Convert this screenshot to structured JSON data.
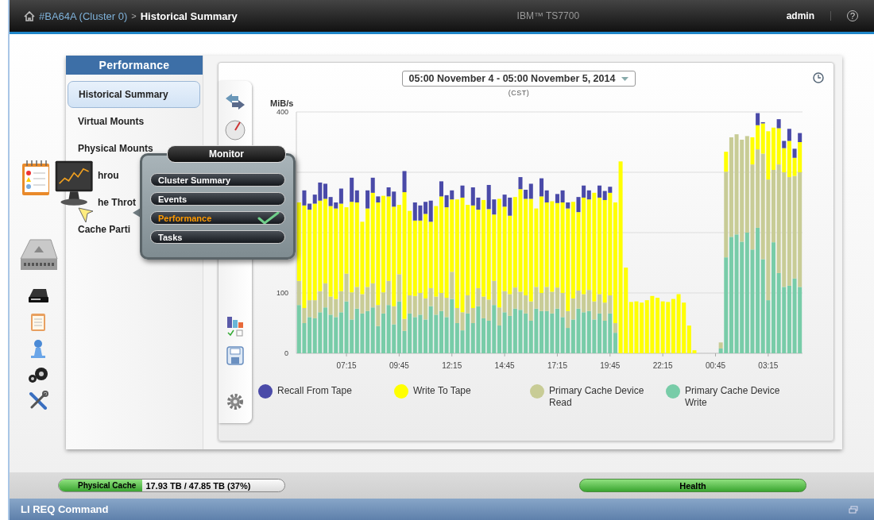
{
  "header": {
    "breadcrumb": [
      {
        "label": "#BA64A (Cluster 0)",
        "kind": "link"
      },
      {
        "label": ">",
        "kind": "separator"
      },
      {
        "label": "Historical Summary",
        "kind": "current"
      }
    ],
    "product": "IBM™ TS7700",
    "user": "admin",
    "help": "?"
  },
  "nav": {
    "title": "Performance",
    "items": [
      {
        "label": "Historical Summary",
        "selected": true,
        "covered": false
      },
      {
        "label": "Virtual Mounts",
        "selected": false,
        "covered": false
      },
      {
        "label": "Physical Mounts",
        "selected": false,
        "covered": false
      },
      {
        "label": "hrou",
        "selected": false,
        "covered": true
      },
      {
        "label": "he Throt",
        "selected": false,
        "covered": true
      },
      {
        "label": "Cache Parti",
        "selected": false,
        "covered": false
      }
    ]
  },
  "monitor_menu": {
    "title": "Monitor",
    "items": [
      {
        "label": "Cluster Summary",
        "selected": false
      },
      {
        "label": "Events",
        "selected": false
      },
      {
        "label": "Performance",
        "selected": true
      },
      {
        "label": "Tasks",
        "selected": false
      }
    ]
  },
  "chart_panel": {
    "date_range": "05:00 November 4 - 05:00 November 5, 2014",
    "timezone": "(CST)",
    "chart_data": {
      "type": "bar",
      "stacked": true,
      "ylabel": "MiB/s",
      "ylim": [
        0,
        400
      ],
      "yticks": [
        0,
        100,
        400
      ],
      "categories": [
        null,
        null,
        null,
        null,
        null,
        null,
        null,
        null,
        null,
        "07:15",
        null,
        null,
        null,
        null,
        null,
        null,
        null,
        null,
        null,
        "09:45",
        null,
        null,
        null,
        null,
        null,
        null,
        null,
        null,
        null,
        "12:15",
        null,
        null,
        null,
        null,
        null,
        null,
        null,
        null,
        null,
        "14:45",
        null,
        null,
        null,
        null,
        null,
        null,
        null,
        null,
        null,
        "17:15",
        null,
        null,
        null,
        null,
        null,
        null,
        null,
        null,
        null,
        "19:45",
        null,
        null,
        null,
        null,
        null,
        null,
        null,
        null,
        null,
        "22:15",
        null,
        null,
        null,
        null,
        null,
        null,
        null,
        null,
        null,
        "00:45",
        null,
        null,
        null,
        null,
        null,
        null,
        null,
        null,
        null,
        "03:15",
        null,
        null,
        null,
        null,
        null,
        null
      ],
      "series": [
        {
          "name": "Recall From Tape",
          "color": "#4a4aa8",
          "values": [
            0,
            25,
            10,
            15,
            30,
            25,
            15,
            10,
            25,
            0,
            40,
            20,
            0,
            30,
            25,
            10,
            0,
            15,
            25,
            0,
            35,
            0,
            30,
            25,
            20,
            35,
            0,
            25,
            20,
            15,
            0,
            20,
            0,
            30,
            20,
            0,
            40,
            25,
            0,
            20,
            30,
            0,
            20,
            15,
            25,
            0,
            30,
            20,
            0,
            15,
            20,
            10,
            0,
            25,
            20,
            15,
            0,
            20,
            15,
            10,
            0,
            0,
            0,
            0,
            0,
            0,
            0,
            0,
            0,
            0,
            0,
            0,
            0,
            0,
            0,
            0,
            0,
            0,
            0,
            0,
            0,
            0,
            0,
            0,
            0,
            0,
            0,
            20,
            2,
            0,
            0,
            15,
            12,
            20,
            15,
            15
          ]
        },
        {
          "name": "Write To Tape",
          "color": "#ffff00",
          "values": [
            130,
            170,
            150,
            160,
            150,
            140,
            150,
            150,
            145,
            110,
            150,
            140,
            120,
            130,
            150,
            170,
            160,
            140,
            165,
            115,
            210,
            140,
            125,
            120,
            140,
            110,
            150,
            160,
            150,
            120,
            180,
            190,
            150,
            170,
            130,
            160,
            150,
            110,
            180,
            140,
            130,
            150,
            170,
            160,
            170,
            130,
            160,
            140,
            150,
            140,
            150,
            170,
            160,
            130,
            160,
            150,
            180,
            160,
            170,
            170,
            200,
            318,
            142,
            85,
            86,
            84,
            88,
            95,
            92,
            86,
            85,
            90,
            98,
            84,
            46,
            5,
            0,
            0,
            0,
            0,
            0,
            33,
            0,
            0,
            0,
            0,
            45,
            40,
            50,
            80,
            70,
            60,
            40,
            60,
            30,
            50
          ]
        },
        {
          "name": "Primary Cache Device Read",
          "color": "#c8cc96",
          "values": [
            40,
            25,
            28,
            30,
            35,
            40,
            30,
            30,
            35,
            46,
            45,
            36,
            32,
            40,
            40,
            35,
            35,
            40,
            30,
            45,
            20,
            30,
            35,
            36,
            35,
            30,
            30,
            30,
            32,
            45,
            25,
            30,
            30,
            25,
            30,
            36,
            35,
            40,
            30,
            35,
            36,
            35,
            30,
            30,
            32,
            36,
            30,
            40,
            36,
            35,
            40,
            28,
            35,
            30,
            30,
            35,
            30,
            32,
            30,
            30,
            16,
            0,
            0,
            0,
            0,
            0,
            0,
            0,
            0,
            0,
            0,
            0,
            0,
            0,
            0,
            0,
            0,
            0,
            0,
            0,
            10,
            142,
            165,
            166,
            169,
            160,
            141,
            130,
            175,
            200,
            120,
            180,
            190,
            180,
            170,
            190
          ]
        },
        {
          "name": "Primary Cache Device Write",
          "color": "#78cca8",
          "values": [
            80,
            50,
            60,
            58,
            68,
            76,
            64,
            60,
            68,
            86,
            56,
            74,
            66,
            70,
            76,
            45,
            66,
            80,
            48,
            86,
            37,
            66,
            60,
            64,
            56,
            78,
            64,
            70,
            60,
            90,
            50,
            38,
            66,
            50,
            78,
            58,
            54,
            80,
            46,
            68,
            62,
            74,
            72,
            66,
            54,
            74,
            70,
            70,
            66,
            74,
            60,
            42,
            56,
            74,
            68,
            70,
            56,
            66,
            54,
            66,
            34,
            0,
            0,
            0,
            0,
            0,
            0,
            0,
            0,
            0,
            0,
            0,
            0,
            0,
            0,
            0,
            0,
            0,
            0,
            0,
            8,
            159,
            193,
            197,
            185,
            200,
            172,
            208,
            156,
            88,
            184,
            133,
            110,
            112,
            124,
            110
          ]
        }
      ]
    }
  },
  "status": {
    "physical_cache": {
      "label": "Physical Cache",
      "reading": "17.93 TB / 47.85 TB (37%)",
      "level": 0.37
    },
    "health": {
      "label": "Health"
    }
  },
  "command_bar": {
    "title": "LI REQ Command"
  }
}
